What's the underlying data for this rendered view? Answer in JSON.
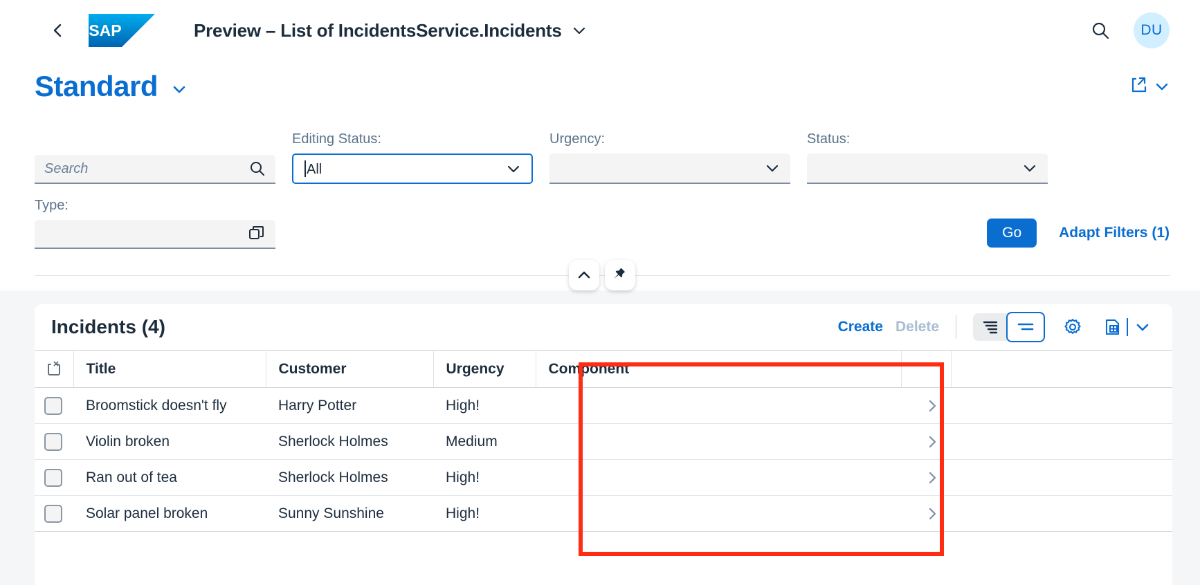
{
  "shellbar": {
    "back_icon": "chevron-left-icon",
    "logo_text": "SAP",
    "title": "Preview – List of IncidentsService.Incidents",
    "title_chevron": "chevron-down-icon",
    "search_icon": "search-icon",
    "avatar_initials": "DU"
  },
  "variant": {
    "name": "Standard",
    "chevron": "chevron-down-icon",
    "share_icon": "share-icon",
    "share_chevron": "chevron-down-icon"
  },
  "filters": {
    "search": {
      "label": "",
      "placeholder": "Search",
      "value": "",
      "icon": "search-icon"
    },
    "editing_status": {
      "label": "Editing Status:",
      "value": "All",
      "icon": "chevron-down-icon"
    },
    "urgency": {
      "label": "Urgency:",
      "value": "",
      "icon": "chevron-down-icon"
    },
    "status": {
      "label": "Status:",
      "value": "",
      "icon": "chevron-down-icon"
    },
    "type": {
      "label": "Type:",
      "value": "",
      "icon": "value-help-icon"
    },
    "go_label": "Go",
    "adapt_label": "Adapt Filters (1)",
    "collapse_icon": "chevron-up-icon",
    "pin_icon": "pin-icon"
  },
  "table": {
    "title": "Incidents (4)",
    "create_label": "Create",
    "delete_label": "Delete",
    "sort_icon": "sort-descending-icon",
    "group_icon": "group-lines-icon",
    "settings_icon": "gear-icon",
    "export_icon": "export-spreadsheet-icon",
    "export_chevron": "chevron-down-icon",
    "deselect_all_icon": "deselect-all-icon",
    "columns": [
      "Title",
      "Customer",
      "Urgency",
      "Component"
    ],
    "rows": [
      {
        "title": "Broomstick doesn't fly",
        "customer": "Harry Potter",
        "urgency": "High!",
        "component": "",
        "nav_icon": "chevron-right-icon"
      },
      {
        "title": "Violin broken",
        "customer": "Sherlock Holmes",
        "urgency": "Medium",
        "component": "",
        "nav_icon": "chevron-right-icon"
      },
      {
        "title": "Ran out of tea",
        "customer": "Sherlock Holmes",
        "urgency": "High!",
        "component": "",
        "nav_icon": "chevron-right-icon"
      },
      {
        "title": "Solar panel broken",
        "customer": "Sunny Sunshine",
        "urgency": "High!",
        "component": "",
        "nav_icon": "chevron-right-icon"
      }
    ]
  },
  "colors": {
    "brand_blue": "#0a6ed1",
    "text_dark": "#1d2d3e",
    "label_grey": "#5b738b",
    "urgency_orange": "#c35500",
    "highlight_red": "#ff2d13",
    "avatar_bg": "#d1efff"
  }
}
